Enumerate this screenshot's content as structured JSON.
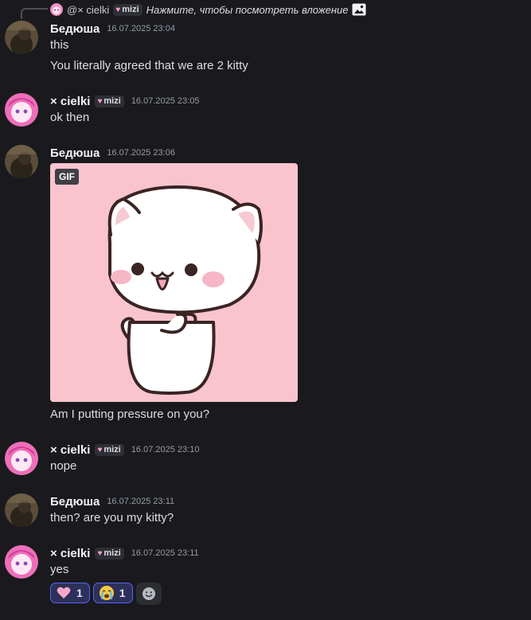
{
  "reply": {
    "author": "@× cielki",
    "tag": "mizi",
    "text": "Нажмите, чтобы посмотреть вложение"
  },
  "messages": [
    {
      "author": "Бедюша",
      "timestamp": "16.07.2025 23:04",
      "lines": [
        "this",
        "You literally agreed that we are 2 kitty"
      ]
    },
    {
      "author": "× cielki",
      "tag": "mizi",
      "timestamp": "16.07.2025 23:05",
      "lines": [
        "ok then"
      ]
    },
    {
      "author": "Бедюша",
      "timestamp": "16.07.2025 23:06",
      "gif_label": "GIF",
      "lines": [
        "Am I putting pressure on you?"
      ]
    },
    {
      "author": "× cielki",
      "tag": "mizi",
      "timestamp": "16.07.2025 23:10",
      "lines": [
        "nope"
      ]
    },
    {
      "author": "Бедюша",
      "timestamp": "16.07.2025 23:11",
      "lines": [
        "then? are you my kitty?"
      ]
    },
    {
      "author": "× cielki",
      "tag": "mizi",
      "timestamp": "16.07.2025 23:11",
      "lines": [
        "yes"
      ]
    }
  ],
  "reactions": [
    {
      "emoji": "pink-heart",
      "count": "1"
    },
    {
      "emoji": "crying-face",
      "count": "1"
    }
  ],
  "icons": {
    "reply_attachment": "image-icon",
    "add_reaction": "smiley-add-icon"
  },
  "colors": {
    "background": "#1a1a1e",
    "reaction_accent": "#5865f2",
    "gif_background": "#fac4cf"
  }
}
